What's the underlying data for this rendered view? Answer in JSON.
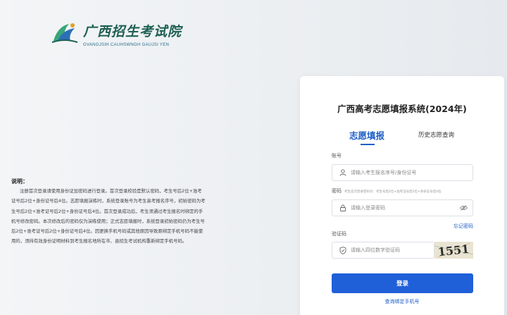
{
  "brand": {
    "name_cn": "广西招生考试院",
    "name_en": "GVANGJSIH CAUHSWNGH GAUJSI YEN"
  },
  "instructions": {
    "title": "说明：",
    "body": "注册首次登录请使用身份证加密码进行登录。首次登录校验是默认密码，考生号后2位+准考证号后2位+身份证号后4位。志愿填报演练时，系统登录账号为考生高考报名序号，初始密码为考生号后2位+准考证号后2位+身份证号后4位。首次登录成功后，考生须通过考生报名时绑定的手机号修改密码。本次修改后的密码仅为演练使用；正式志愿填报时，系统登录初始密码仍为考生号后2位+准考证号后2位+身份证号后4位。因更换手机号码或其他原因导致原绑定手机号码不能使用的，须持有效身份证明材料到考生报名地所在市、县招生考试机构重新绑定手机号码。"
  },
  "login": {
    "system_title": "广西高考志愿填报系统(2024年)",
    "tabs": [
      {
        "label": "志愿填报",
        "active": true
      },
      {
        "label": "历史志愿查询",
        "active": false
      }
    ],
    "account_label": "账号",
    "account_placeholder": "请输入考生报名序号/身份证号",
    "password_label": "密码",
    "password_hint": "考生首次登录密码为：考生号后2位+准考证号后2位+身份证号后4位",
    "password_placeholder": "请输入登录密码",
    "forgot_label": "忘记密码",
    "captcha_label": "验证码",
    "captcha_placeholder": "请输入四位数字验证码",
    "captcha_text": "1551",
    "login_button": "登录",
    "bind_phone_link": "查询绑定手机号"
  },
  "colors": {
    "accent": "#1f5fd8",
    "brand_green": "#1f5f54"
  }
}
